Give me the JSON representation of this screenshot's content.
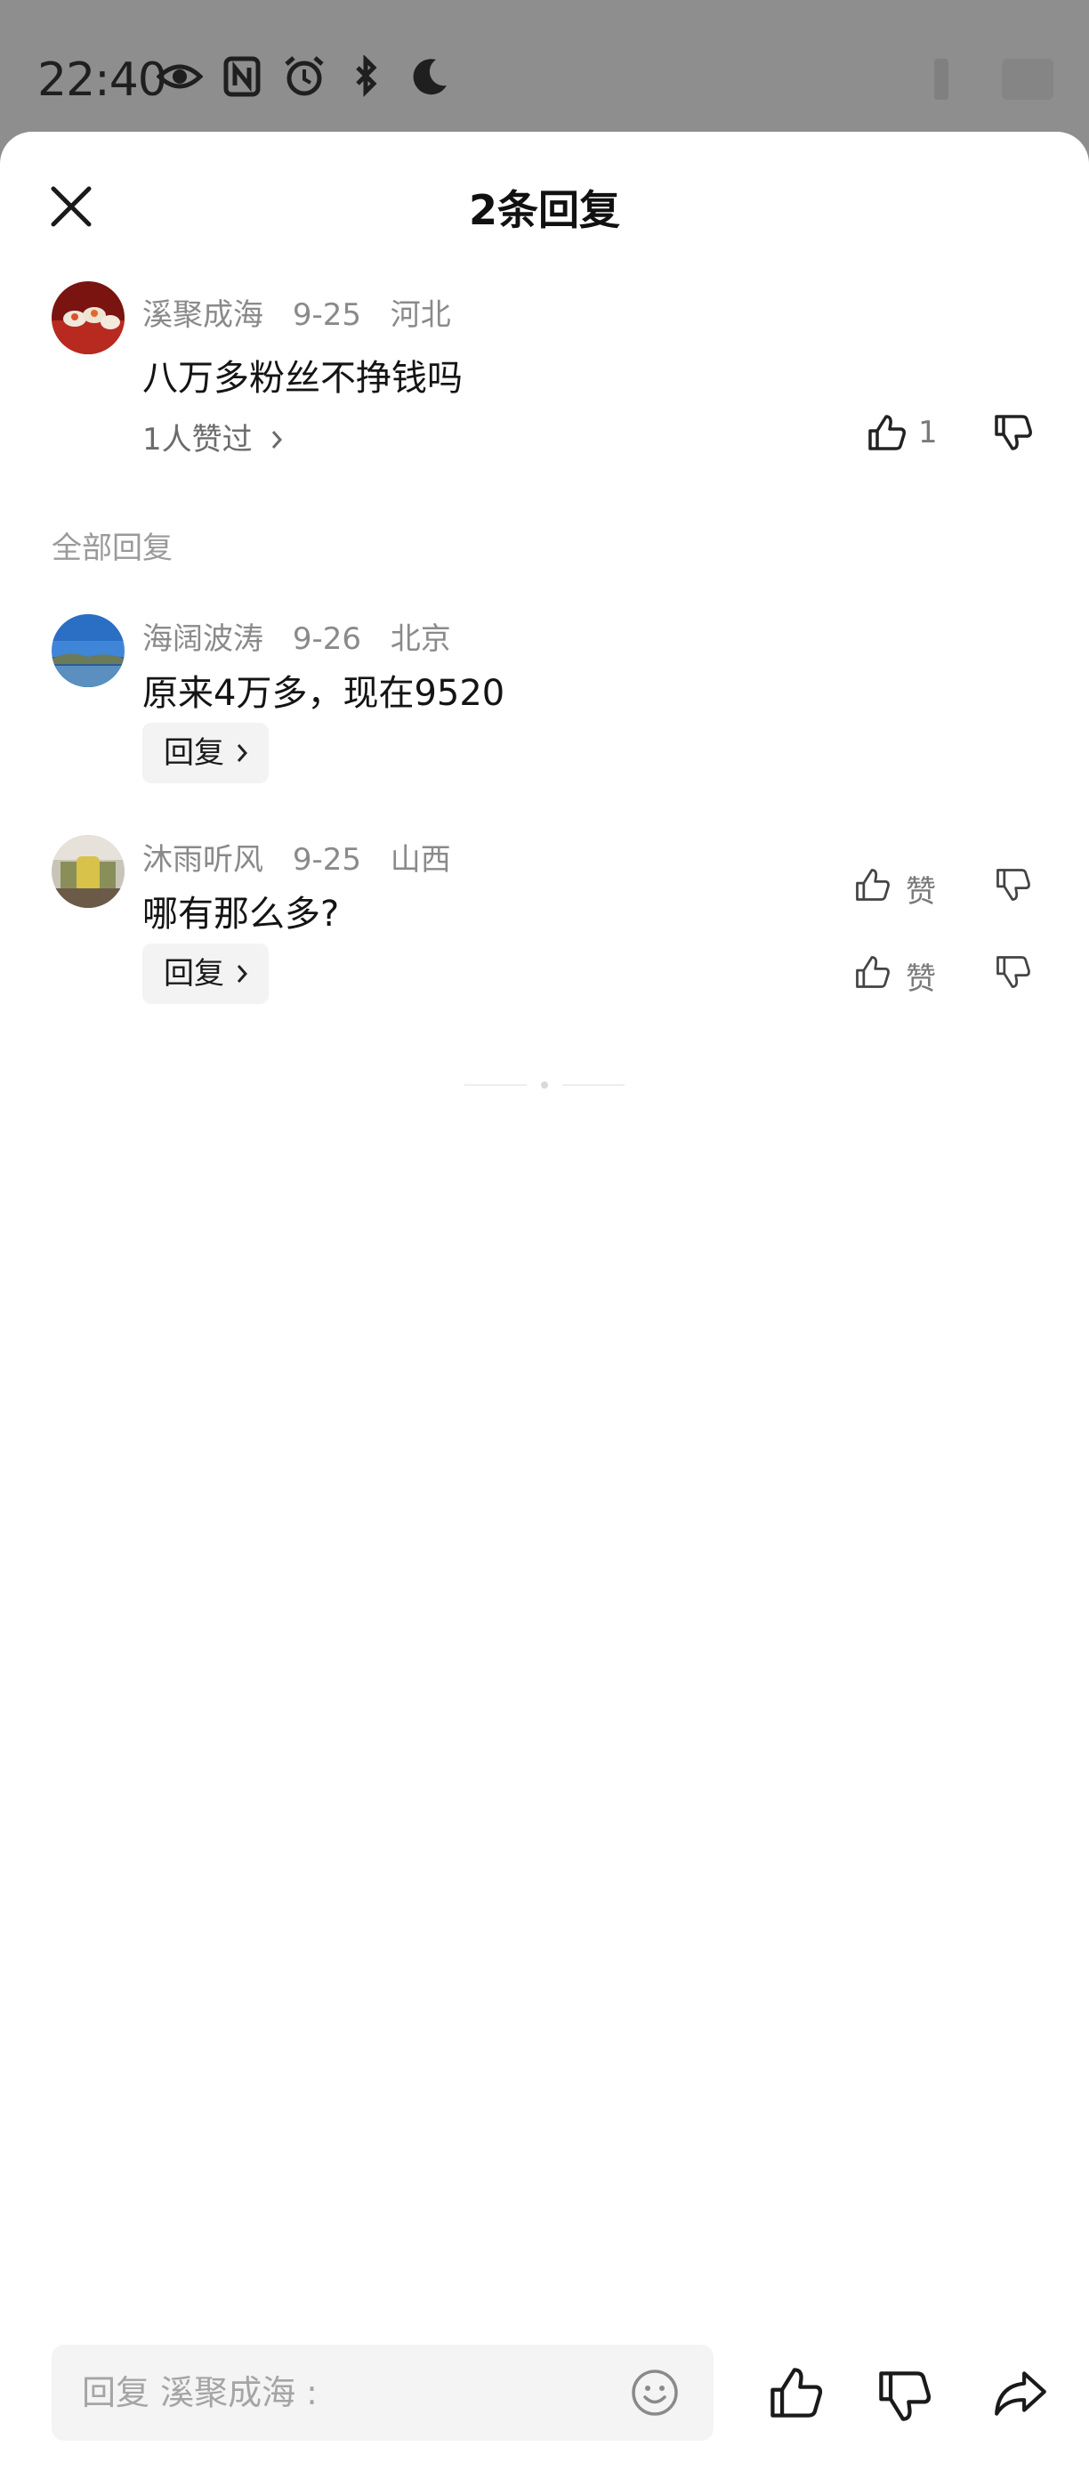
{
  "status_bar": {
    "time": "22:40"
  },
  "sheet": {
    "title": "2条回复"
  },
  "main_comment": {
    "username": "溪聚成海",
    "date": "9-25",
    "location": "河北",
    "text": "八万多粉丝不挣钱吗",
    "likers": "1人赞过",
    "like_count": "1"
  },
  "section_label": "全部回复",
  "replies": [
    {
      "username": "海阔波涛",
      "date": "9-26",
      "location": "北京",
      "text": "原来4万多，现在9520",
      "reply_label": "回复",
      "like_label": "赞"
    },
    {
      "username": "沐雨听风",
      "date": "9-25",
      "location": "山西",
      "text": "哪有那么多?",
      "reply_label": "回复",
      "like_label": "赞"
    }
  ],
  "bottom_bar": {
    "placeholder": "回复 溪聚成海 :"
  }
}
